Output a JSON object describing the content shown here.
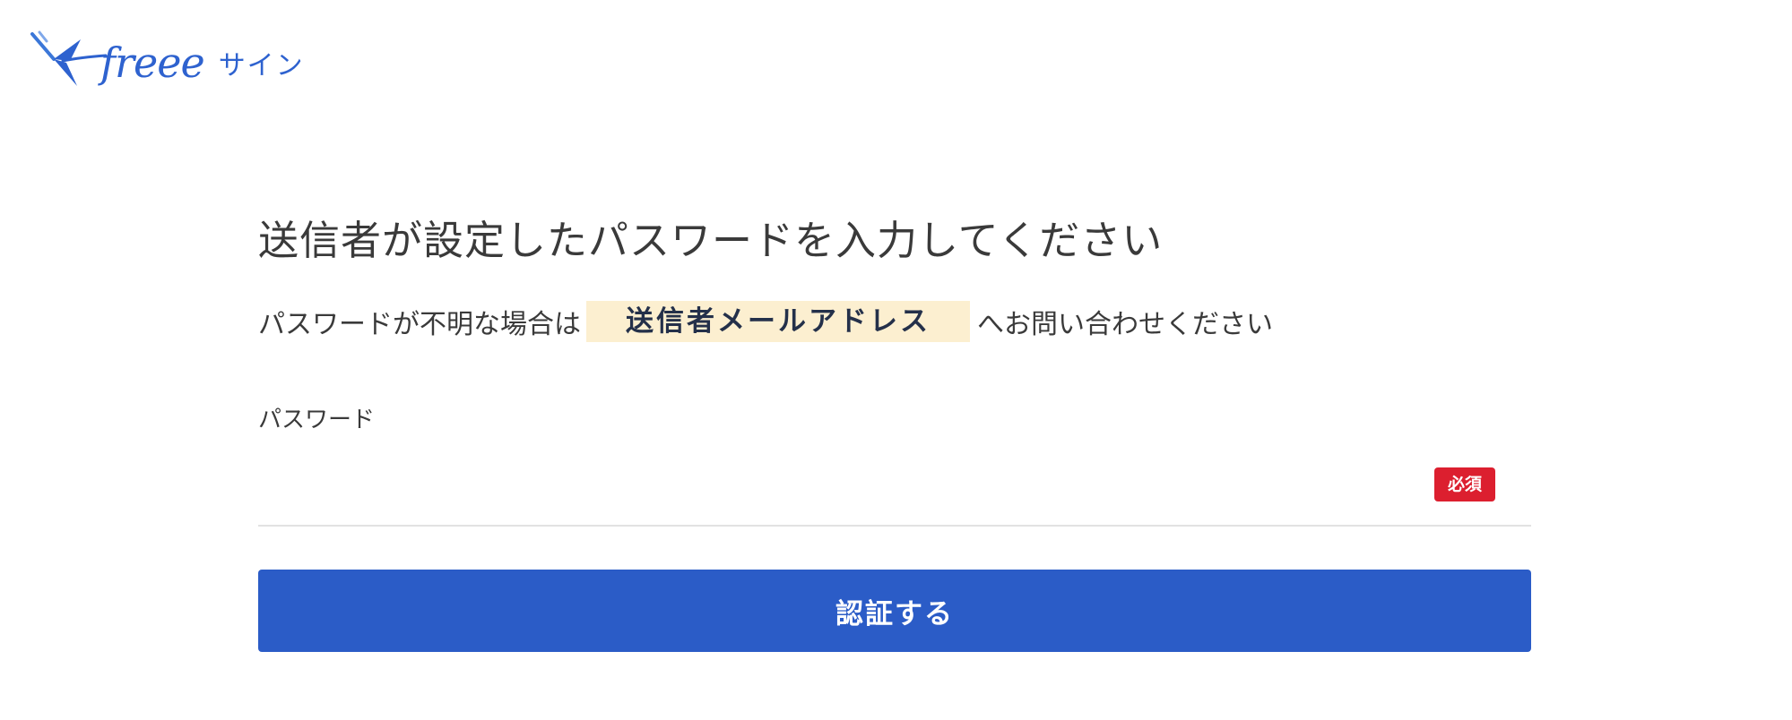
{
  "header": {
    "logo_brand": "freee",
    "logo_product": "サイン",
    "logo_icon": "bird-pen-icon"
  },
  "main": {
    "title": "送信者が設定したパスワードを入力してください",
    "info_prefix": "パスワードが不明な場合は",
    "info_email": "送信者メールアドレス",
    "info_suffix": "へお問い合わせください"
  },
  "form": {
    "password_label": "パスワード",
    "password_value": "",
    "required_badge": "必須",
    "submit_label": "認証する"
  },
  "colors": {
    "brand_blue": "#2e62cf",
    "button_blue": "#2b5cc7",
    "required_red": "#dc1f2f",
    "email_highlight": "#fcefd0"
  }
}
